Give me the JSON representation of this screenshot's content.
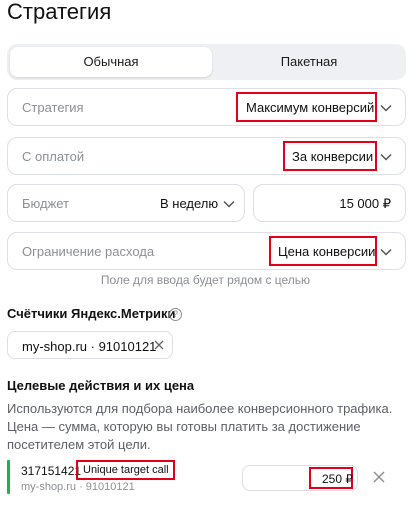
{
  "page_title": "Стратегия",
  "tabs": [
    {
      "label": "Обычная",
      "active": true
    },
    {
      "label": "Пакетная",
      "active": false
    }
  ],
  "strategy": {
    "label": "Стратегия",
    "value": "Максимум конверсий"
  },
  "payment": {
    "label": "С оплатой",
    "value": "За конверсии"
  },
  "budget": {
    "label": "Бюджет",
    "period": "В неделю",
    "amount": "15 000 ₽"
  },
  "limit": {
    "label": "Ограничение расхода",
    "value": "Цена конверсии"
  },
  "hint": "Поле для ввода будет рядом с целью",
  "metrika": {
    "title": "Счётчики Яндекс.Метрики",
    "counter": "my-shop.ru · 91010121"
  },
  "goals": {
    "title": "Целевые действия и их цена",
    "description": "Используются для подбора наиболее конверсионного трафика. Цена — сумма, которую вы готовы платить за достижение посетителем этой цели.",
    "items": [
      {
        "id": "317151421",
        "name": "Unique target call",
        "counter": "my-shop.ru · 91010121",
        "price": "250 ₽"
      }
    ]
  },
  "colors": {
    "highlight": "#e3001b",
    "goal_bar": "#21b04b",
    "muted": "#8c8f94"
  }
}
